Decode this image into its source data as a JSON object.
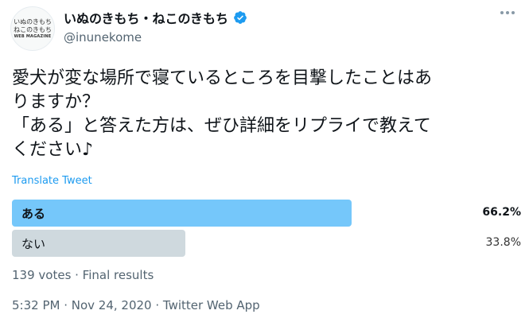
{
  "account": {
    "avatar_text": [
      "いぬのきもち",
      "ねこのきもち",
      "WEB MAGAZINE"
    ],
    "display_name": "いぬのきもち・ねこのきもち",
    "handle": "@inunekome"
  },
  "tweet": {
    "lines": [
      "愛犬が変な場所で寝ているところを目撃したことはあ",
      "りますか？",
      "「ある」と答えた方は、ぜひ詳細をリプライで教えて",
      "ください♪"
    ],
    "translate_label": "Translate Tweet"
  },
  "poll": {
    "options": [
      {
        "label": "ある",
        "percent_text": "66.2%",
        "percent": 66.2,
        "winner": true
      },
      {
        "label": "ない",
        "percent_text": "33.8%",
        "percent": 33.8,
        "winner": false
      }
    ],
    "meta": "139 votes · Final results"
  },
  "timestamp": "5:32 PM · Nov 24, 2020 · Twitter Web App",
  "colors": {
    "accent": "#1d9bf0",
    "winner_bar": "#75c7fa",
    "other_bar": "#cfd9de"
  },
  "icons": {
    "verified": "verified-badge-icon",
    "more": "more-dots-icon"
  }
}
